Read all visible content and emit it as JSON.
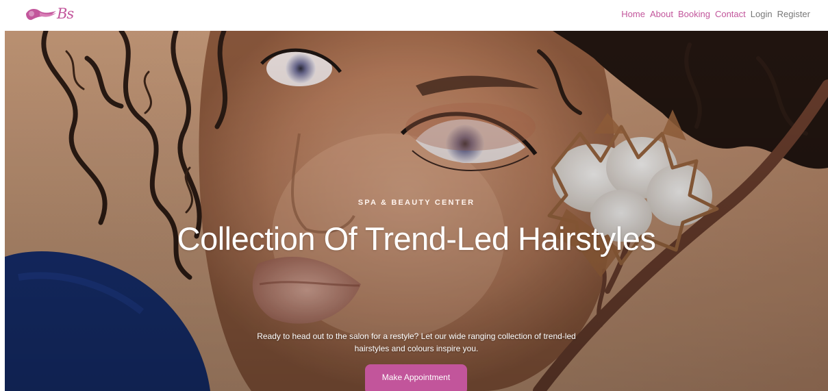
{
  "brand": {
    "logo_text": "Bs",
    "icon": "hair-swoosh-icon",
    "accent_color": "#c2559b"
  },
  "nav": {
    "items": [
      {
        "label": "Home",
        "color": "#c2559b"
      },
      {
        "label": "About",
        "color": "#c2559b"
      },
      {
        "label": "Booking",
        "color": "#c2559b"
      },
      {
        "label": "Contact",
        "color": "#c2559b"
      },
      {
        "label": "Login",
        "color": "#777777"
      },
      {
        "label": "Register",
        "color": "#777777"
      }
    ]
  },
  "hero": {
    "eyebrow": "SPA & BEAUTY CENTER",
    "headline": "Collection Of Trend-Led Hairstyles",
    "subtext": "Ready to head out to the salon for a restyle? Let our wide ranging collection of trend-led hairstyles and colours inspire you.",
    "cta_label": "Make Appointment"
  }
}
